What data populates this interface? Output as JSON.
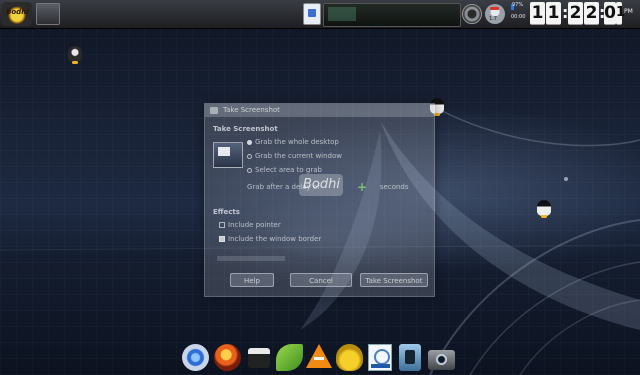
{
  "top_panel": {
    "menu_logo_text": "Bodhi",
    "icons": [
      "bodhi-menu-icon",
      "show-desktop-icon",
      "device-icon",
      "system-meter-icon",
      "volume-icon",
      "cpu-gauge-icon",
      "battery-icon"
    ],
    "cpu_gauge_value": "1.7",
    "battery_percent": "97%",
    "small_clock": "00:00",
    "clock": {
      "h1": "1",
      "h2": "1",
      "m1": "2",
      "m2": "2",
      "s1": "0",
      "s2": "1",
      "sep": ":",
      "ampm": "PM"
    }
  },
  "dialog": {
    "title": "Take Screenshot",
    "section_take": "Take Screenshot",
    "options": [
      "Grab the whole desktop",
      "Grab the current window",
      "Select area to grab"
    ],
    "selected_option_index": 0,
    "delay_label": "Grab after a delay of",
    "delay_unit": "seconds",
    "watermark_text": "Bodhi",
    "section_effects": "Effects",
    "effects": [
      {
        "label": "Include pointer",
        "checked": false
      },
      {
        "label": "Include the window border",
        "checked": true
      }
    ],
    "buttons": {
      "help": "Help",
      "cancel": "Cancel",
      "take": "Take Screenshot"
    }
  },
  "dock": {
    "items": [
      "chromium-icon",
      "firefox-icon",
      "terminal-icon",
      "leafpad-icon",
      "vlc-icon",
      "teapot-icon",
      "document-viewer-icon",
      "media-player-icon",
      "camera-icon"
    ]
  },
  "colors": {
    "panel": "#2a2d33",
    "wallpaper_dark": "#0e1524",
    "wallpaper_mid": "#1d2a42",
    "clock_face": "#f4f4f4"
  }
}
